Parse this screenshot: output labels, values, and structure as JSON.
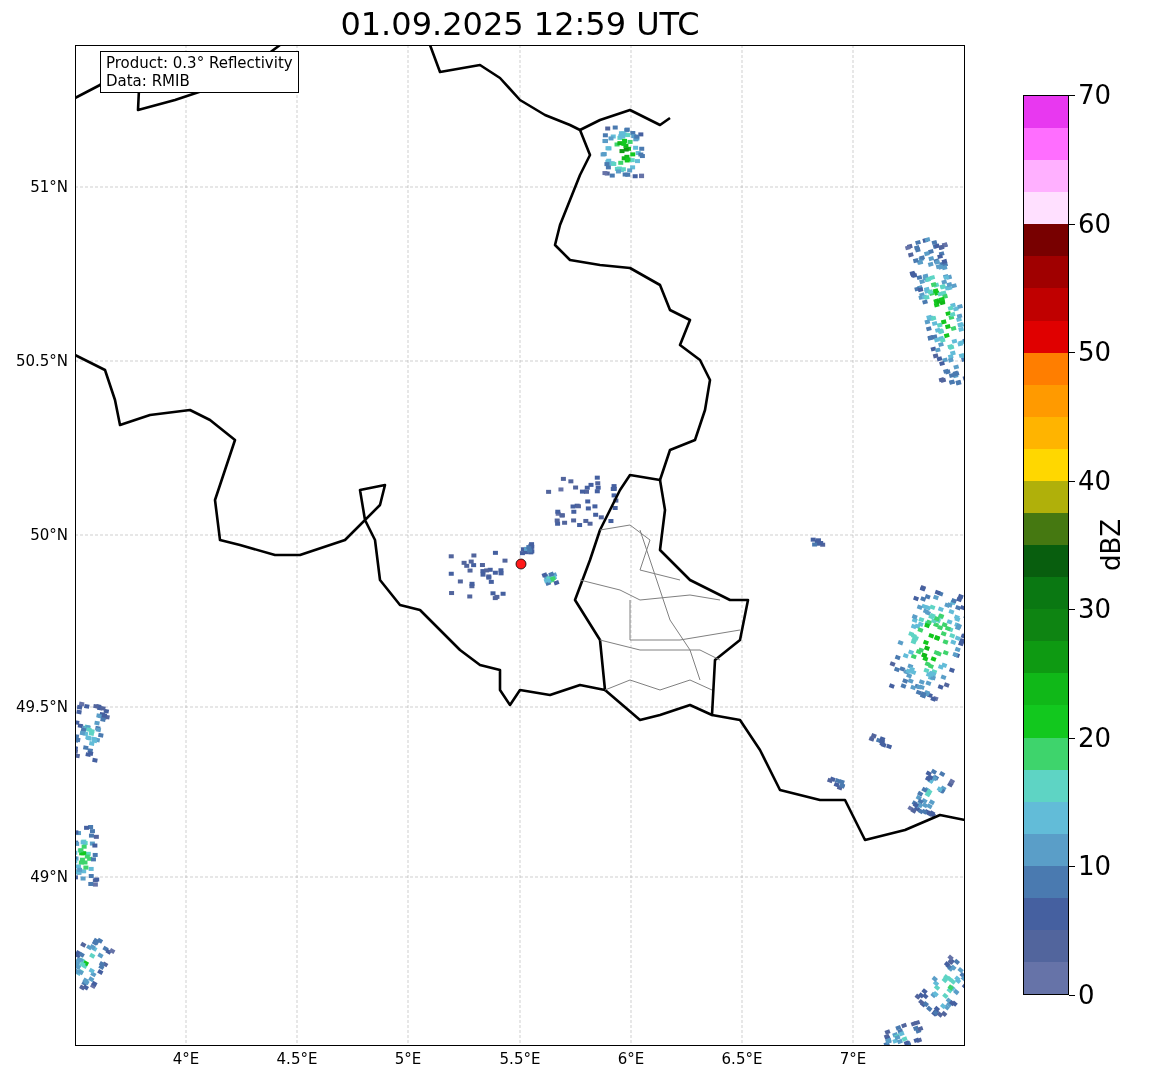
{
  "title": "01.09.2025 12:59 UTC",
  "info_box": {
    "lines": [
      "Product: 0.3° Reflectivity",
      "Data: RMIB"
    ]
  },
  "map": {
    "x_ticks": [
      "4°E",
      "4.5°E",
      "5°E",
      "5.5°E",
      "6°E",
      "6.5°E",
      "7°E"
    ],
    "y_ticks": [
      "51°N",
      "50.5°N",
      "50°N",
      "49.5°N",
      "49°N"
    ]
  },
  "colorbar": {
    "label": "dBZ",
    "ticks": [
      "70",
      "60",
      "50",
      "40",
      "30",
      "20",
      "10",
      "0"
    ],
    "segments": [
      {
        "color": "#e838f0"
      },
      {
        "color": "#ff6eff"
      },
      {
        "color": "#ffb0ff"
      },
      {
        "color": "#ffe0ff"
      },
      {
        "color": "#780000"
      },
      {
        "color": "#a00000"
      },
      {
        "color": "#c00000"
      },
      {
        "color": "#e00000"
      },
      {
        "color": "#ff7e00"
      },
      {
        "color": "#ff9a00"
      },
      {
        "color": "#ffb400"
      },
      {
        "color": "#ffd700"
      },
      {
        "color": "#b0b00a"
      },
      {
        "color": "#457811"
      },
      {
        "color": "#085e0e"
      },
      {
        "color": "#0a7812"
      },
      {
        "color": "#0e8412"
      },
      {
        "color": "#0e9a12"
      },
      {
        "color": "#10b818"
      },
      {
        "color": "#12c81e"
      },
      {
        "color": "#3ed46c"
      },
      {
        "color": "#5ed4c4"
      },
      {
        "color": "#62bcd8"
      },
      {
        "color": "#5a9ec8"
      },
      {
        "color": "#4a7ab0"
      },
      {
        "color": "#4560a0"
      },
      {
        "color": "#52659d"
      },
      {
        "color": "#6673a8"
      }
    ]
  }
}
